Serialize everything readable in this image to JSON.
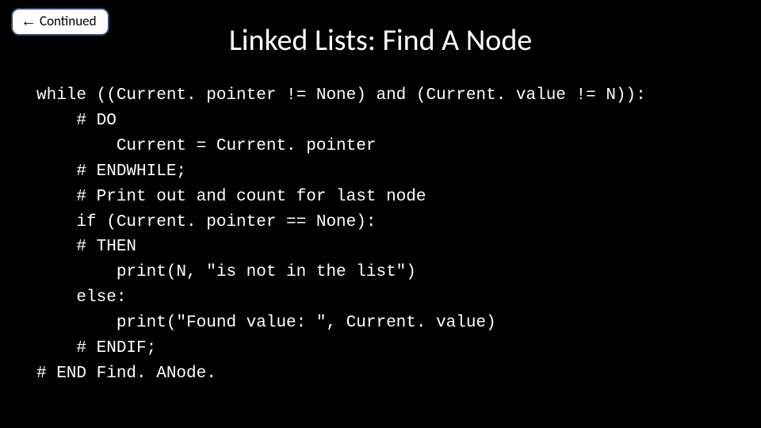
{
  "nav": {
    "continued_label": "Continued"
  },
  "slide": {
    "title": "Linked Lists: Find A Node"
  },
  "code": {
    "line1": "while ((Current. pointer != None) and (Current. value != N)):",
    "line2": "    # DO",
    "line3": "        Current = Current. pointer",
    "line4": "    # ENDWHILE;",
    "line5": "    # Print out and count for last node",
    "line6": "    if (Current. pointer == None):",
    "line7": "    # THEN",
    "line8": "        print(N, \"is not in the list\")",
    "line9": "    else:",
    "line10": "        print(\"Found value: \", Current. value)",
    "line11": "    # ENDIF;",
    "line12": "# END Find. ANode."
  }
}
